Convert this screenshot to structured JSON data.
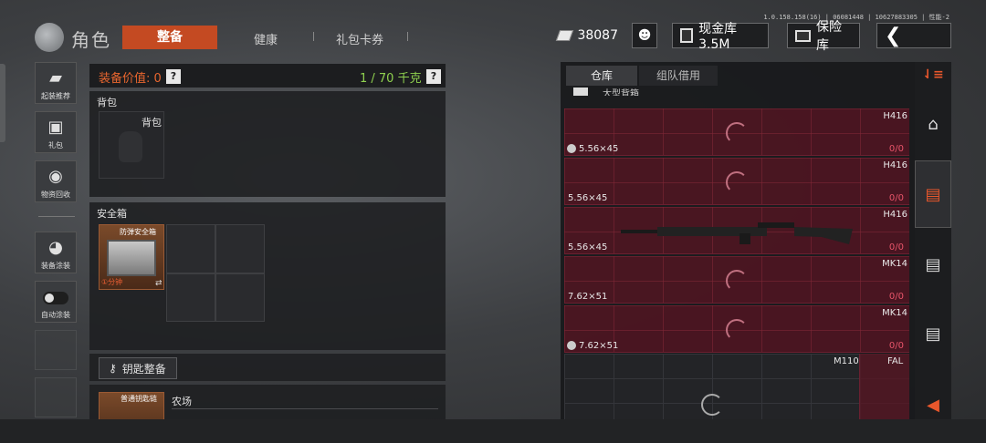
{
  "header": {
    "title": "角色",
    "tabs": [
      "整备",
      "健康",
      "礼包卡券"
    ],
    "version": "1.0.158.158(16) | 06081448 | 10627883305 | 性能-2",
    "currency_amount": "38087",
    "cash_vault_label": "现金库 3.5M",
    "safe_label": "保险库"
  },
  "sidebar": {
    "items": [
      {
        "label": "起装推荐",
        "icon": "gun-icon"
      },
      {
        "label": "礼包",
        "icon": "gift-icon"
      },
      {
        "label": "物资回收",
        "icon": "recycle-icon"
      },
      {
        "label": "装备涂装",
        "icon": "helmet-icon"
      },
      {
        "label": "自动涂装",
        "icon": "toggle-icon"
      }
    ]
  },
  "loadout": {
    "equip_value": "装备价值: 0",
    "weight": "1 / 70 千克",
    "backpack_section": "背包",
    "backpack_slot_label": "背包",
    "safebox_section": "安全箱",
    "safebox_item": "防弹安全箱",
    "safebox_time": "①分钟",
    "key_button": "钥匙整备",
    "keychain_label": "普通钥匙链",
    "farm_label": "农场"
  },
  "storage": {
    "tabs": [
      "仓库",
      "组队借用"
    ],
    "partial_label": "大型背箱",
    "rows": [
      {
        "weapon": "H416",
        "ammo": "5.56×45",
        "count": "0/0",
        "has_icon": true
      },
      {
        "weapon": "H416",
        "ammo": "5.56×45",
        "count": "0/0",
        "has_icon": false
      },
      {
        "weapon": "H416",
        "ammo": "5.56×45",
        "count": "0/0",
        "has_icon": false
      },
      {
        "weapon": "MK14",
        "ammo": "7.62×51",
        "count": "0/0",
        "has_icon": false
      },
      {
        "weapon": "MK14",
        "ammo": "7.62×51",
        "count": "0/0",
        "has_icon": true
      }
    ],
    "bottom_labels": [
      "M110",
      "FAL"
    ]
  },
  "colors": {
    "accent": "#c44a22",
    "weight_green": "#8fd14f",
    "count_red": "#e8556a",
    "row_maroon": "#5a1423"
  }
}
